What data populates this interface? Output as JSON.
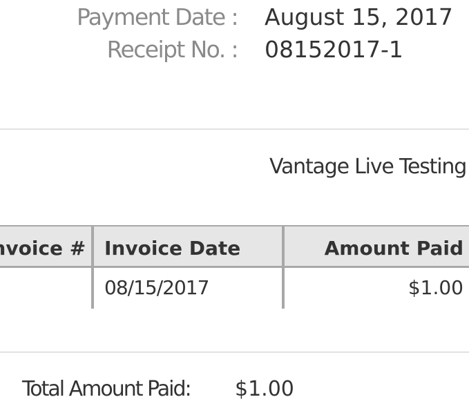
{
  "receipt": {
    "payment_date_label": "Payment Date :",
    "payment_date_value": "August 15, 2017",
    "receipt_no_label": "Receipt No. :",
    "receipt_no_value": "08152017-1"
  },
  "company": {
    "name": "Vantage Live Testing"
  },
  "table": {
    "headers": [
      "Invoice #",
      "Invoice Date",
      "Amount Paid"
    ],
    "rows": [
      {
        "invoice_number": "",
        "invoice_date": "08/15/2017",
        "amount_paid": "$1.00"
      }
    ]
  },
  "total": {
    "label": "Total Amount Paid:",
    "value": "$1.00"
  }
}
